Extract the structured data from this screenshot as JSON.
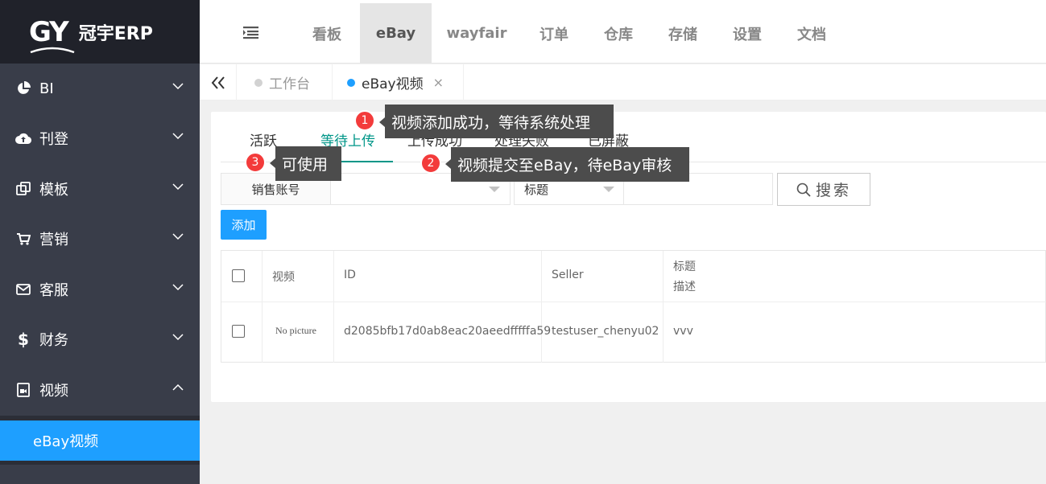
{
  "app": {
    "logo_mark": "GY",
    "logo_text": "冠宇ERP"
  },
  "sidebar": {
    "items": [
      {
        "label": "BI",
        "icon": "pie-chart-icon"
      },
      {
        "label": "刊登",
        "icon": "cloud-upload-icon"
      },
      {
        "label": "模板",
        "icon": "template-icon"
      },
      {
        "label": "营销",
        "icon": "cart-icon"
      },
      {
        "label": "客服",
        "icon": "mail-icon"
      },
      {
        "label": "财务",
        "icon": "dollar-icon"
      },
      {
        "label": "视频",
        "icon": "video-file-icon"
      }
    ],
    "sub_item": "eBay视频"
  },
  "header": {
    "tabs": [
      "看板",
      "eBay",
      "wayfair",
      "订单",
      "仓库",
      "存储",
      "设置",
      "文档"
    ],
    "active_tab": "eBay"
  },
  "page_tabs": [
    {
      "label": "工作台",
      "dot_color": "#d2d2d2"
    },
    {
      "label": "eBay视频",
      "dot_color": "#1e9fff",
      "close": "×"
    }
  ],
  "content_tabs": [
    "活跃",
    "等待上传",
    "上传成功",
    "处理失败",
    "已屏蔽"
  ],
  "active_content_tab": "等待上传",
  "filters": {
    "account_label": "销售账号",
    "field_select": "标题",
    "search_label": "搜索"
  },
  "add_button": "添加",
  "table": {
    "headers": {
      "video": "视频",
      "id": "ID",
      "seller": "Seller",
      "title": "标题",
      "desc": "描述"
    },
    "rows": [
      {
        "video": "No picture",
        "id": "d2085bfb17d0ab8eac20aeedfffffa59",
        "seller": "testuser_chenyu02",
        "title": "vvv"
      }
    ]
  },
  "tooltips": [
    {
      "badge": "1",
      "text": "视频添加成功，等待系统处理"
    },
    {
      "badge": "2",
      "text": "视频提交至eBay，待eBay审核"
    },
    {
      "badge": "3",
      "text": "可使用"
    }
  ],
  "colors": {
    "sidebar": "#393d49",
    "logo_bg": "#20222a",
    "accent_blue": "#1e9fff",
    "tab_green": "#009688",
    "badge_red": "#f33b3b"
  }
}
